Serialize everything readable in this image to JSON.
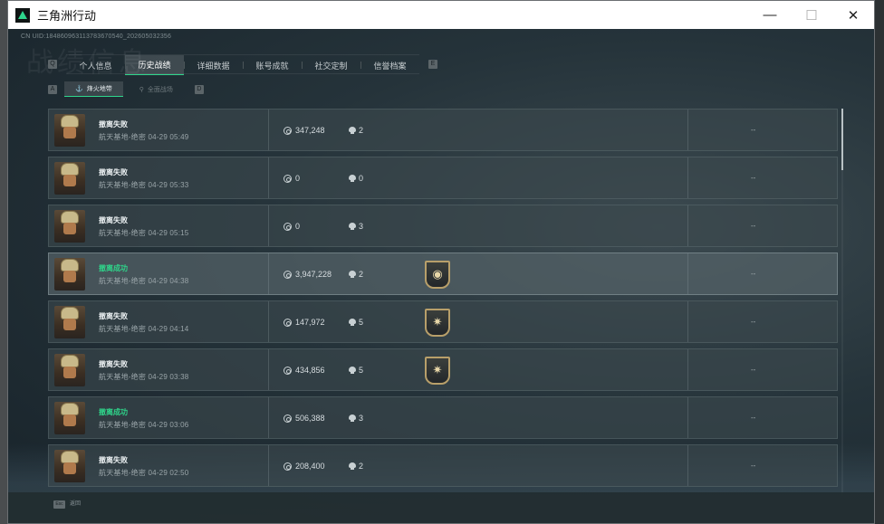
{
  "window": {
    "title": "三角洲行动",
    "minimize_glyph": "—",
    "maximize_glyph": "☐",
    "close_glyph": "✕"
  },
  "page": {
    "uid_line": "CN UID:184860963113783670540_202605032356",
    "background_title": "战绩信息"
  },
  "nav": {
    "key_left": "Q",
    "key_right": "E",
    "tabs": [
      {
        "label": "个人信息"
      },
      {
        "label": "历史战绩",
        "active": true
      },
      {
        "label": "详细数据"
      },
      {
        "label": "账号成就"
      },
      {
        "label": "社交定制"
      },
      {
        "label": "信誉档案"
      }
    ]
  },
  "subnav": {
    "key_left": "A",
    "key_right": "D",
    "tabs": [
      {
        "label": "烽火地带",
        "icon": "extraction-icon",
        "active": true
      },
      {
        "label": "全面战场",
        "icon": "warfare-icon"
      }
    ]
  },
  "matches": [
    {
      "result": "撤离失败",
      "success": false,
      "map": "航天基地-绝密",
      "time": "04-29 05:49",
      "value": "347,248",
      "kills": "2",
      "badge": null,
      "extra": "--"
    },
    {
      "result": "撤离失败",
      "success": false,
      "map": "航天基地-绝密",
      "time": "04-29 05:33",
      "value": "0",
      "kills": "0",
      "badge": null,
      "extra": "--"
    },
    {
      "result": "撤离失败",
      "success": false,
      "map": "航天基地-绝密",
      "time": "04-29 05:15",
      "value": "0",
      "kills": "3",
      "badge": null,
      "extra": "--"
    },
    {
      "result": "撤离成功",
      "success": true,
      "map": "航天基地-绝密",
      "time": "04-29 04:38",
      "value": "3,947,228",
      "kills": "2",
      "badge": "medal-icon",
      "extra": "--"
    },
    {
      "result": "撤离失败",
      "success": false,
      "map": "航天基地-绝密",
      "time": "04-29 04:14",
      "value": "147,972",
      "kills": "5",
      "badge": "star-badge-icon",
      "extra": "--"
    },
    {
      "result": "撤离失败",
      "success": false,
      "map": "航天基地-绝密",
      "time": "04-29 03:38",
      "value": "434,856",
      "kills": "5",
      "badge": "star-badge-icon",
      "extra": "--"
    },
    {
      "result": "撤离成功",
      "success": true,
      "map": "航天基地-绝密",
      "time": "04-29 03:06",
      "value": "506,388",
      "kills": "3",
      "badge": null,
      "extra": "--"
    },
    {
      "result": "撤离失败",
      "success": false,
      "map": "航天基地-绝密",
      "time": "04-29 02:50",
      "value": "208,400",
      "kills": "2",
      "badge": null,
      "extra": "--"
    }
  ],
  "footer": {
    "esc_key": "Esc",
    "back_label": "返回"
  },
  "colors": {
    "accent": "#2ed68c",
    "success_text": "#2fd48a",
    "badge_border": "#b89f6a"
  },
  "scroll": {
    "position_fraction": 0.0,
    "visible_fraction": 0.16
  }
}
